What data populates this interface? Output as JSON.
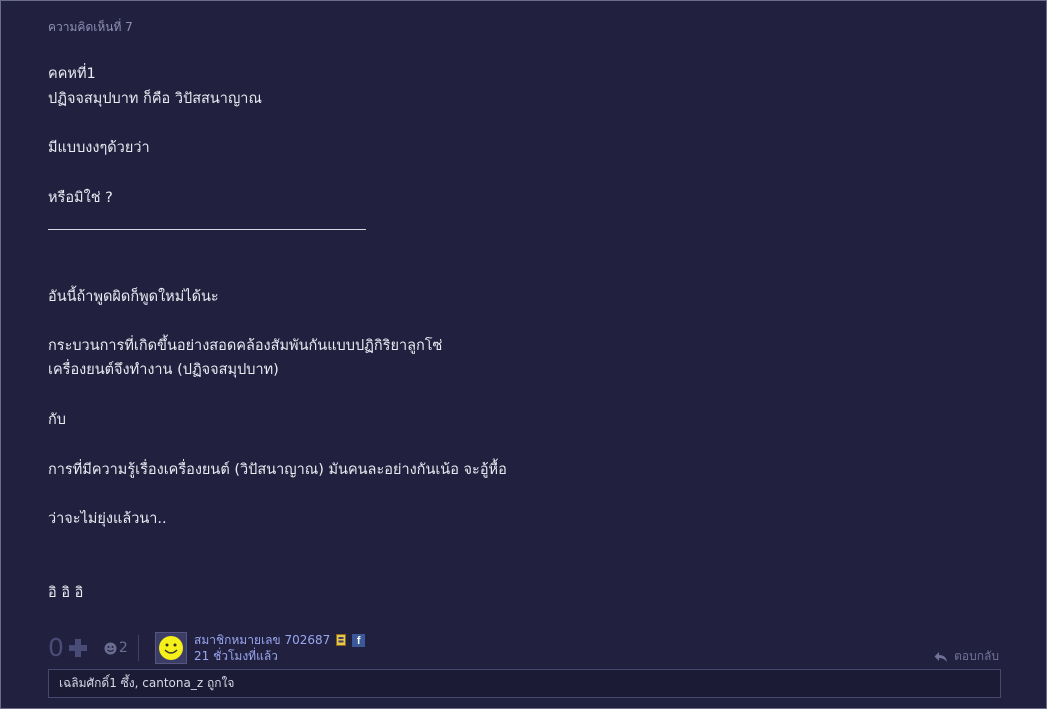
{
  "comment": {
    "number_label": "ความคิดเห็นที่ 7",
    "lines": [
      "คคหที่1",
      "ปฏิจจสมุปบาท ก็คือ วิปัสสนาญาณ",
      "มีแบบงงๆด้วยว่า",
      "หรือมิใช่ ?",
      "อันนี้ถ้าพูดผิดก็พูดใหม่ได้นะ",
      "กระบวนการที่เกิดขึ้นอย่างสอดคล้องสัมพันกันแบบปฏิกิริยาลูกโซ่",
      "เครื่องยนต์จึงทำงาน (ปฏิจจสมุปบาท)",
      "กับ",
      "การที่มีความรู้เรื่องเครื่องยนต์ (วิปัสนาญาณ) มันคนละอย่างกันเน้อ จะอู้หื้อ",
      "ว่าจะไม่ยุ่งแล้วนา..",
      "อิ อิ อิ"
    ]
  },
  "footer": {
    "vote_count": "0",
    "emotion_count": "2",
    "member_name": "สมาชิกหมายเลข 702687",
    "post_time": "21 ชั่วโมงที่แล้ว",
    "facebook_letter": "f",
    "reply_label": "ตอบกลับ",
    "likes_text": "เฉลิมศักดิ์1 ซึ้ง, cantona_z ถูกใจ"
  },
  "colors": {
    "background": "#21213f",
    "text": "#ebebf3",
    "muted": "#8d8fb4",
    "link": "#9aa6f0",
    "facebook": "#3b5998"
  },
  "icons": [
    "plus-icon",
    "emotion-face-icon",
    "avatar-smiley-icon",
    "member-badge-icon",
    "facebook-icon",
    "reply-arrow-icon"
  ]
}
